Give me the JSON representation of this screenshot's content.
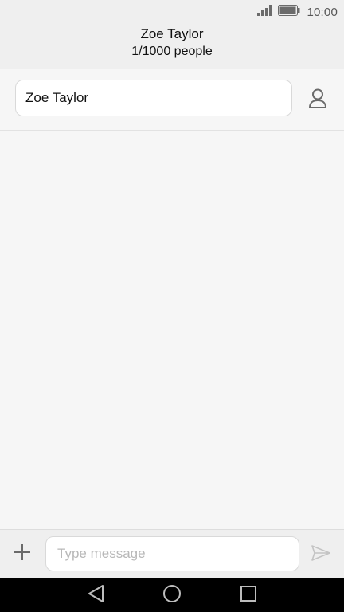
{
  "status_bar": {
    "time": "10:00",
    "icons": [
      "signal-icon",
      "battery-icon"
    ]
  },
  "header": {
    "title": "Zoe Taylor",
    "subtitle": "1/1000 people"
  },
  "recipient": {
    "value": "Zoe Taylor",
    "contact_icon": "person-icon"
  },
  "compose": {
    "placeholder": "Type message",
    "attach_icon": "plus-icon",
    "send_icon": "send-icon"
  },
  "nav_bar": {
    "buttons": [
      "back-icon",
      "home-icon",
      "recent-apps-icon"
    ]
  },
  "colors": {
    "header_bg": "#efefef",
    "body_bg": "#f6f6f6",
    "nav_bg": "#000000"
  }
}
